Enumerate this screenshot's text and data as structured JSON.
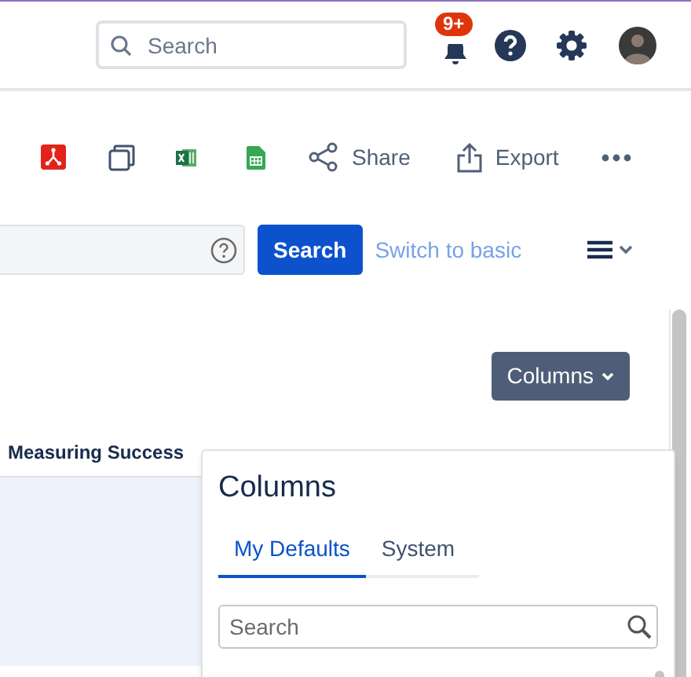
{
  "header": {
    "search": {
      "placeholder": "Search"
    },
    "notifications": {
      "badge": "9+"
    }
  },
  "toolbar": {
    "buttons": [
      {
        "kind": "pdf"
      },
      {
        "kind": "copy"
      },
      {
        "kind": "excel"
      },
      {
        "kind": "sheets"
      },
      {
        "kind": "share",
        "label": "Share"
      },
      {
        "kind": "export",
        "label": "Export"
      },
      {
        "kind": "more"
      }
    ]
  },
  "query": {
    "search_button": "Search",
    "switch_link": "Switch to basic"
  },
  "columns_button": {
    "label": "Columns"
  },
  "table": {
    "columns": [
      {
        "label": "Measuring Success"
      }
    ]
  },
  "columns_popup": {
    "title": "Columns",
    "tabs": [
      {
        "label": "My Defaults",
        "selected": true
      },
      {
        "label": "System",
        "selected": false
      }
    ],
    "search": {
      "placeholder": "Search"
    }
  }
}
